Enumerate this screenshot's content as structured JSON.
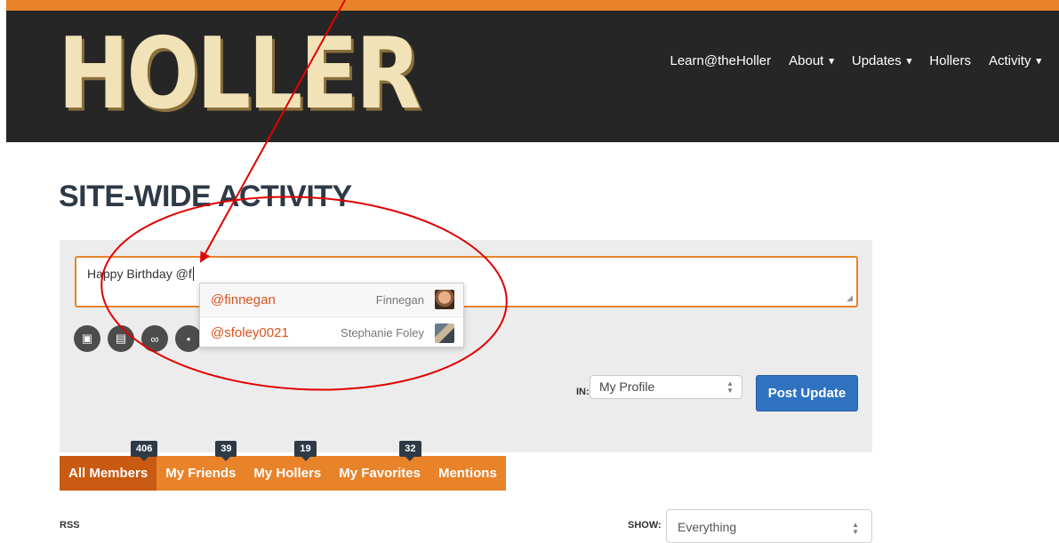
{
  "header": {
    "logo_text": "HOLLER",
    "nav": [
      {
        "label": "Learn@theHoller",
        "dropdown": false
      },
      {
        "label": "About",
        "dropdown": true
      },
      {
        "label": "Updates",
        "dropdown": true
      },
      {
        "label": "Hollers",
        "dropdown": false
      },
      {
        "label": "Activity",
        "dropdown": true
      }
    ],
    "chevron": "⌄"
  },
  "page_title": "SITE-WIDE ACTIVITY",
  "post_form": {
    "text_value": "Happy Birthday @f",
    "tool_icons": [
      "image-icon",
      "video-icon",
      "link-icon",
      "more-icon"
    ],
    "in_label": "IN:",
    "post_in_value": "My Profile",
    "post_button": "Post Update"
  },
  "autocomplete": [
    {
      "handle": "@finnegan",
      "name": "Finnegan"
    },
    {
      "handle": "@sfoley0021",
      "name": "Stephanie Foley"
    }
  ],
  "tabs": [
    {
      "label": "All Members",
      "count": "406",
      "active": true
    },
    {
      "label": "My Friends",
      "count": "39",
      "active": false
    },
    {
      "label": "My Hollers",
      "count": "19",
      "active": false
    },
    {
      "label": "My Favorites",
      "count": "32",
      "active": false
    },
    {
      "label": "Mentions",
      "count": null,
      "active": false
    }
  ],
  "filters": {
    "rss_label": "RSS",
    "show_label": "SHOW:",
    "show_value": "Everything"
  },
  "colors": {
    "accent": "#e8832a",
    "header_bg": "#262626",
    "button_blue": "#2f73c0",
    "annotation_red": "#e00000"
  }
}
